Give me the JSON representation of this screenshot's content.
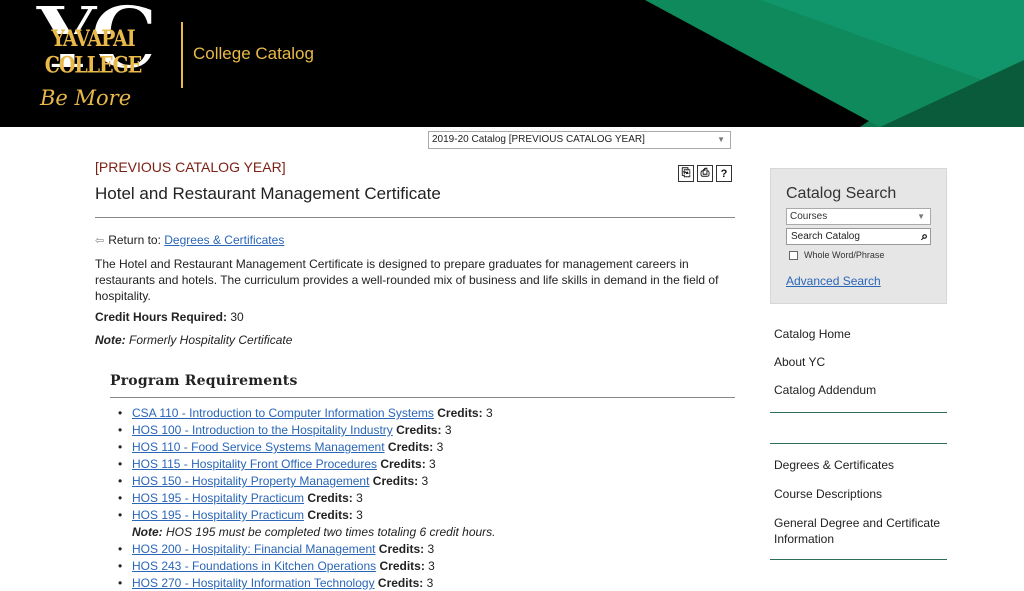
{
  "header": {
    "logo_letters": "YC",
    "logo_name": "YAVAPAI COLLEGE",
    "logo_tagline": "Be More",
    "title": "College Catalog",
    "colors": {
      "gold": "#e9b949",
      "green": "#0f8a5c",
      "dark_green": "#0a5a3c"
    }
  },
  "catalog_select": {
    "value": "2019-20 Catalog [PREVIOUS CATALOG YEAR]"
  },
  "main": {
    "prev_year": "[PREVIOUS CATALOG YEAR]",
    "title": "Hotel and Restaurant Management Certificate",
    "tools": [
      {
        "name": "share-icon",
        "glyph": "⎘"
      },
      {
        "name": "print-icon",
        "glyph": "⎙"
      },
      {
        "name": "help-icon",
        "glyph": "?"
      }
    ],
    "return_label": "Return to:",
    "return_link": "Degrees & Certificates",
    "description": "The Hotel and Restaurant Management Certificate is designed to prepare graduates for management careers in restaurants and hotels. The curriculum provides a well-rounded mix of business and life skills in demand in the field of hospitality.",
    "credit_hours_label": "Credit Hours Required:",
    "credit_hours_value": "30",
    "note_label": "Note:",
    "note_text": "Formerly Hospitality Certificate",
    "requirements_title": "Program Requirements",
    "credits_label": "Credits:",
    "requirements": [
      {
        "course": "CSA 110 - Introduction to Computer Information Systems",
        "credits": "3"
      },
      {
        "course": "HOS 100 - Introduction to the Hospitality Industry",
        "credits": "3"
      },
      {
        "course": "HOS 110 - Food Service Systems Management",
        "credits": "3"
      },
      {
        "course": "HOS 115 - Hospitality Front Office Procedures",
        "credits": "3"
      },
      {
        "course": "HOS 150 - Hospitality Property Management",
        "credits": "3"
      },
      {
        "course": "HOS 195 - Hospitality Practicum",
        "credits": "3"
      },
      {
        "course": "HOS 195 - Hospitality Practicum",
        "credits": "3"
      },
      {
        "note_label": "Note:",
        "note_text": "HOS 195 must be completed two times totaling 6 credit hours."
      },
      {
        "course": "HOS 200 - Hospitality: Financial Management",
        "credits": "3"
      },
      {
        "course": "HOS 243 - Foundations in Kitchen Operations",
        "credits": "3"
      },
      {
        "course": "HOS 270 - Hospitality Information Technology",
        "credits": "3"
      }
    ]
  },
  "sidebar": {
    "search_title": "Catalog Search",
    "search_type": "Courses",
    "search_placeholder": "Search Catalog",
    "whole_word_label": "Whole Word/Phrase",
    "advanced_search": "Advanced Search",
    "nav_group1": [
      "Catalog Home",
      "About YC",
      "Catalog Addendum"
    ],
    "nav_group2": [
      "Degrees & Certificates",
      "Course Descriptions",
      "General Degree and Certificate Information"
    ]
  }
}
